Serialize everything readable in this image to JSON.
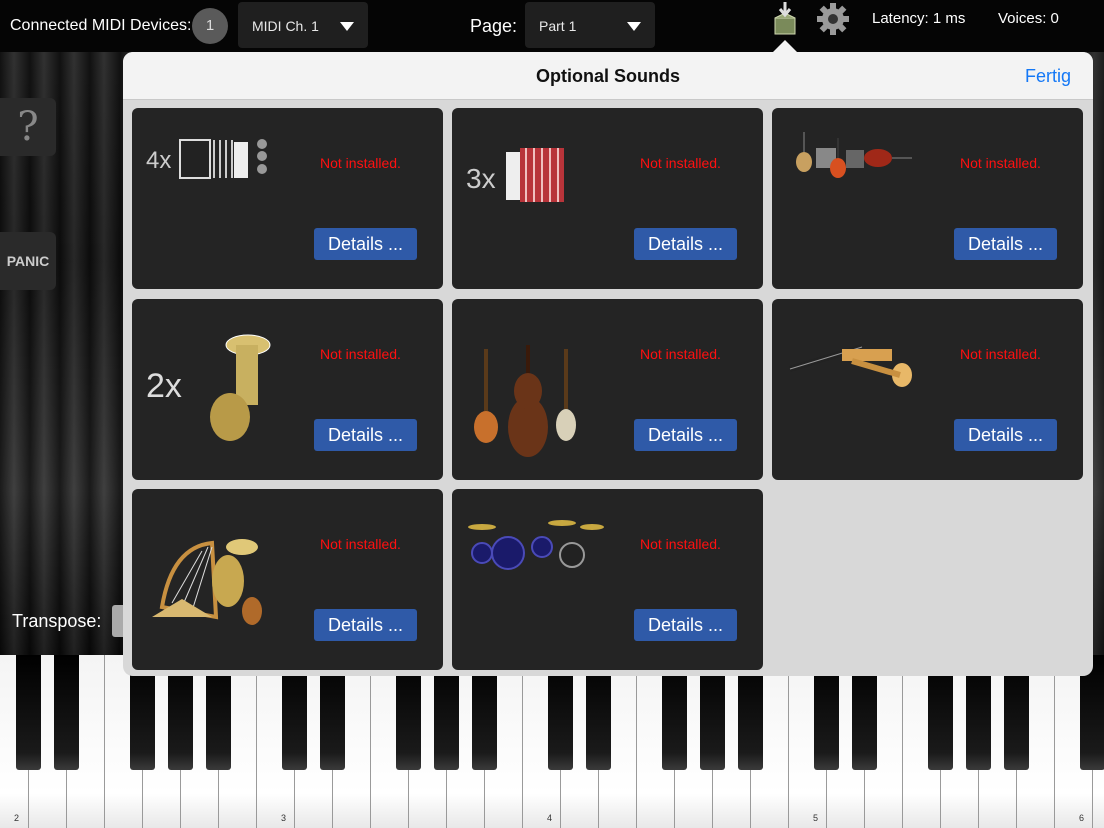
{
  "topbar": {
    "midi_devices_label": "Connected MIDI Devices:",
    "midi_devices_count": "1",
    "midi_channel": "MIDI Ch. 1",
    "page_label": "Page:",
    "page_value": "Part 1",
    "download_icon": "download-box-icon",
    "settings_icon": "gear-icon",
    "latency": "Latency: 1 ms",
    "voices": "Voices:  0"
  },
  "side": {
    "help_label": "?",
    "panic_label": "PANIC",
    "transpose_label": "Transpose:"
  },
  "keyboard": {
    "octave_labels": [
      "2",
      "3",
      "4",
      "5",
      "6"
    ]
  },
  "popover": {
    "title": "Optional Sounds",
    "done_label": "Fertig",
    "cards": [
      {
        "image": "accordion-4x-icon",
        "image_text": "4x",
        "status": "Not installed.",
        "button": "Details ..."
      },
      {
        "image": "accordion-3x-icon",
        "image_text": "3x",
        "status": "Not installed.",
        "button": "Details ..."
      },
      {
        "image": "guitars-amps-icon",
        "image_text": "",
        "status": "Not installed.",
        "button": "Details ..."
      },
      {
        "image": "tuba-2x-icon",
        "image_text": "2x",
        "status": "Not installed.",
        "button": "Details ..."
      },
      {
        "image": "bass-instruments-icon",
        "image_text": "",
        "status": "Not installed.",
        "button": "Details ..."
      },
      {
        "image": "clarinet-trumpet-icon",
        "image_text": "",
        "status": "Not installed.",
        "button": "Details ..."
      },
      {
        "image": "harp-tuba-guitar-icon",
        "image_text": "",
        "status": "Not installed.",
        "button": "Details ..."
      },
      {
        "image": "drum-kit-icon",
        "image_text": "",
        "status": "Not installed.",
        "button": "Details ..."
      }
    ]
  },
  "colors": {
    "status_red": "#ff1010",
    "button_blue": "#2f5aa8",
    "done_blue": "#1478f6",
    "card_bg": "#242424"
  }
}
